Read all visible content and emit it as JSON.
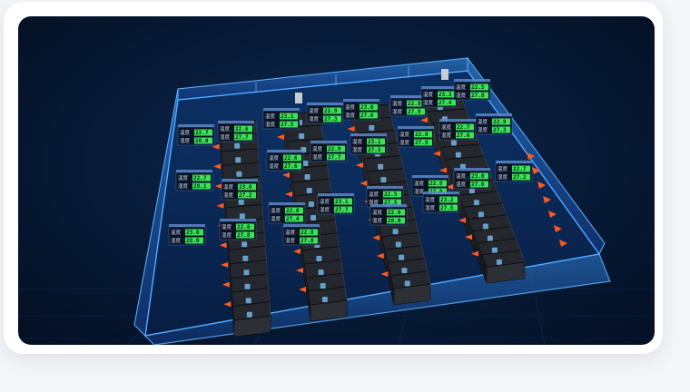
{
  "scene": {
    "name": "3D data center room monitoring view",
    "colors": {
      "background": "#06162e",
      "glass_wall": "#2f8cff",
      "rack_body": "#1b1d22",
      "rack_led": "#7fc8ff",
      "airflow_arrow": "#ff5a1f",
      "sensor_value": "#3be35a",
      "label_bg": "#0a1020"
    },
    "sensors": [
      {
        "l1": "温度",
        "v1": "22.7",
        "l2": "湿度",
        "v2": "28.0"
      },
      {
        "l1": "温度",
        "v1": "22.6",
        "l2": "湿度",
        "v2": "27.7"
      },
      {
        "l1": "温度",
        "v1": "23.1",
        "l2": "湿度",
        "v2": "27.5"
      },
      {
        "l1": "温度",
        "v1": "22.9",
        "l2": "湿度",
        "v2": "27.3"
      },
      {
        "l1": "温度",
        "v1": "23.0",
        "l2": "湿度",
        "v2": "27.6"
      },
      {
        "l1": "温度",
        "v1": "22.8",
        "l2": "湿度",
        "v2": "27.9"
      },
      {
        "l1": "温度",
        "v1": "23.2",
        "l2": "湿度",
        "v2": "27.4"
      },
      {
        "l1": "温度",
        "v1": "22.5",
        "l2": "湿度",
        "v2": "27.8"
      },
      {
        "l1": "温度",
        "v1": "22.7",
        "l2": "湿度",
        "v2": "28.1"
      },
      {
        "l1": "温度",
        "v1": "23.0",
        "l2": "湿度",
        "v2": "27.2"
      },
      {
        "l1": "温度",
        "v1": "22.6",
        "l2": "湿度",
        "v2": "27.6"
      },
      {
        "l1": "温度",
        "v1": "22.9",
        "l2": "湿度",
        "v2": "27.7"
      },
      {
        "l1": "温度",
        "v1": "23.1",
        "l2": "湿度",
        "v2": "27.5"
      },
      {
        "l1": "温度",
        "v1": "22.8",
        "l2": "湿度",
        "v2": "27.9"
      },
      {
        "l1": "温度",
        "v1": "22.7",
        "l2": "湿度",
        "v2": "27.6"
      },
      {
        "l1": "温度",
        "v1": "22.9",
        "l2": "湿度",
        "v2": "27.3"
      },
      {
        "l1": "温度",
        "v1": "23.0",
        "l2": "湿度",
        "v2": "28.0"
      },
      {
        "l1": "温度",
        "v1": "22.6",
        "l2": "湿度",
        "v2": "27.8"
      },
      {
        "l1": "温度",
        "v1": "22.8",
        "l2": "湿度",
        "v2": "27.4"
      },
      {
        "l1": "温度",
        "v1": "23.1",
        "l2": "湿度",
        "v2": "27.7"
      },
      {
        "l1": "温度",
        "v1": "22.5",
        "l2": "湿度",
        "v2": "27.5"
      },
      {
        "l1": "温度",
        "v1": "22.9",
        "l2": "湿度",
        "v2": "27.9"
      },
      {
        "l1": "温度",
        "v1": "23.0",
        "l2": "湿度",
        "v2": "27.6"
      },
      {
        "l1": "温度",
        "v1": "22.7",
        "l2": "湿度",
        "v2": "27.2"
      },
      {
        "l1": "温度",
        "v1": "22.8",
        "l2": "湿度",
        "v2": "27.8"
      },
      {
        "l1": "温度",
        "v1": "22.6",
        "l2": "湿度",
        "v2": "28.0"
      },
      {
        "l1": "温度",
        "v1": "23.2",
        "l2": "湿度",
        "v2": "27.5"
      }
    ]
  }
}
